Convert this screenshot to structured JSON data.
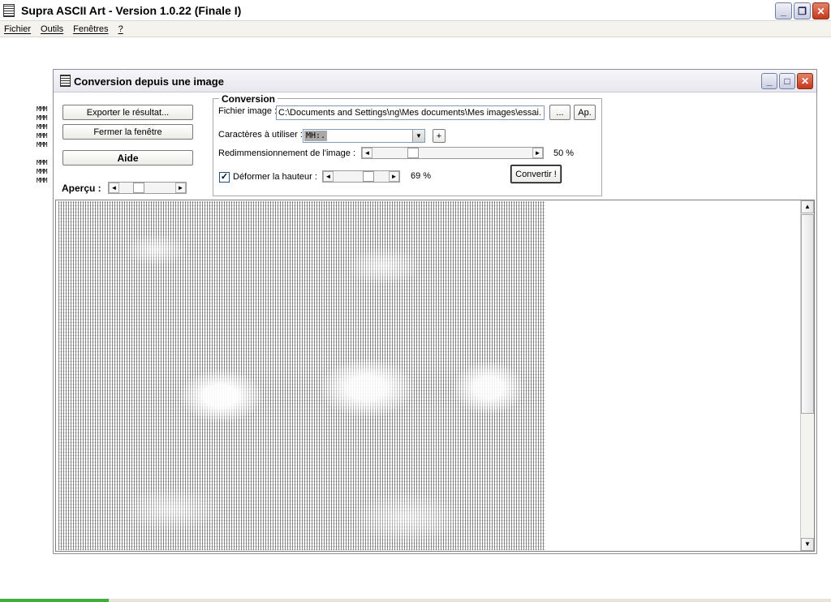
{
  "app": {
    "title": "Supra ASCII Art - Version 1.0.22 (Finale I)"
  },
  "menu": {
    "items": [
      "Fichier",
      "Outils",
      "Fenêtres",
      "?"
    ]
  },
  "child": {
    "title": "Conversion depuis une image",
    "buttons": {
      "export": "Exporter le résultat...",
      "close": "Fermer la fenêtre",
      "help": "Aide"
    },
    "preview_label": "Aperçu :",
    "preview_chars": "MMM",
    "conversion": {
      "group_title": "Conversion",
      "file_label": "Fichier image :",
      "file_value": "C:\\Documents and Settings\\ng\\Mes documents\\Mes images\\essai.",
      "browse_button": "...",
      "preview_button": "Ap.",
      "chars_label": "Caractères à utiliser :",
      "chars_value": "MH:.",
      "add_button": "+",
      "resize_label": "Redimmensionnement de l'image :",
      "resize_percent": "50 %",
      "resize_value": 50,
      "deform_label": "Déformer la hauteur :",
      "deform_checked": true,
      "deform_percent": "69 %",
      "deform_value": 69,
      "convert_button": "Convertir !"
    }
  }
}
